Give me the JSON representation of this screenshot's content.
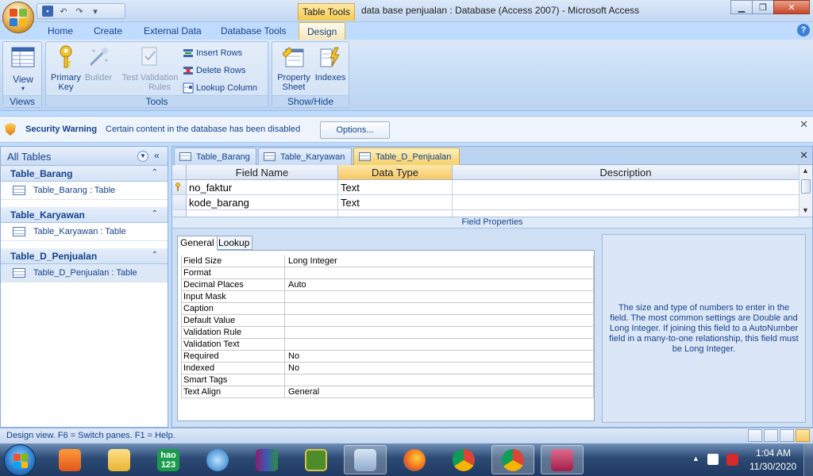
{
  "titlebar": {
    "contextual_label": "Table Tools",
    "window_title": "data base penjualan : Database (Access 2007) - Microsoft Access"
  },
  "ribbon_tabs": [
    "Home",
    "Create",
    "External Data",
    "Database Tools",
    "Design"
  ],
  "ribbon": {
    "views": {
      "view_label": "View",
      "group_label": "Views"
    },
    "tools": {
      "primary_key_line1": "Primary",
      "primary_key_line2": "Key",
      "builder": "Builder",
      "test": "Test",
      "validation_line1": "Validation",
      "validation_line2": "Rules",
      "insert_rows": "Insert Rows",
      "delete_rows": "Delete Rows",
      "lookup_column": "Lookup Column",
      "group_label": "Tools"
    },
    "showhide": {
      "property_line1": "Property",
      "property_line2": "Sheet",
      "indexes": "Indexes",
      "group_label": "Show/Hide"
    }
  },
  "security_bar": {
    "title": "Security Warning",
    "message": "Certain content in the database has been disabled",
    "options_button": "Options..."
  },
  "nav": {
    "title": "All Tables",
    "groups": [
      {
        "title": "Table_Barang",
        "item": "Table_Barang : Table"
      },
      {
        "title": "Table_Karyawan",
        "item": "Table_Karyawan : Table"
      },
      {
        "title": "Table_D_Penjualan",
        "item": "Table_D_Penjualan : Table"
      }
    ]
  },
  "doc_tabs": [
    "Table_Barang",
    "Table_Karyawan",
    "Table_D_Penjualan"
  ],
  "design_grid": {
    "headers": [
      "Field Name",
      "Data Type",
      "Description"
    ],
    "rows": [
      {
        "field": "no_faktur",
        "type": "Text",
        "desc": ""
      },
      {
        "field": "kode_barang",
        "type": "Text",
        "desc": ""
      }
    ]
  },
  "field_properties": {
    "label": "Field Properties",
    "tabs": [
      "General",
      "Lookup"
    ],
    "rows": [
      {
        "label": "Field Size",
        "value": "Long Integer"
      },
      {
        "label": "Format",
        "value": ""
      },
      {
        "label": "Decimal Places",
        "value": "Auto"
      },
      {
        "label": "Input Mask",
        "value": ""
      },
      {
        "label": "Caption",
        "value": ""
      },
      {
        "label": "Default Value",
        "value": ""
      },
      {
        "label": "Validation Rule",
        "value": ""
      },
      {
        "label": "Validation Text",
        "value": ""
      },
      {
        "label": "Required",
        "value": "No"
      },
      {
        "label": "Indexed",
        "value": "No"
      },
      {
        "label": "Smart Tags",
        "value": ""
      },
      {
        "label": "Text Align",
        "value": "General"
      }
    ],
    "help_text": "The size and type of numbers to enter in the field.  The most common settings are Double and Long Integer.  If joining this field to a AutoNumber field in a many-to-one relationship, this field must be Long Integer."
  },
  "statusbar": {
    "text": "Design view.  F6 = Switch panes.  F1 = Help."
  },
  "taskbar": {
    "hao_line1": "hao",
    "hao_line2": "123",
    "time": "1:04 AM",
    "date": "11/30/2020"
  },
  "colors": {
    "ribbon_blue": "#bfdbff",
    "active_tab_gold": "#f6c865",
    "text_blue": "#15428b"
  }
}
